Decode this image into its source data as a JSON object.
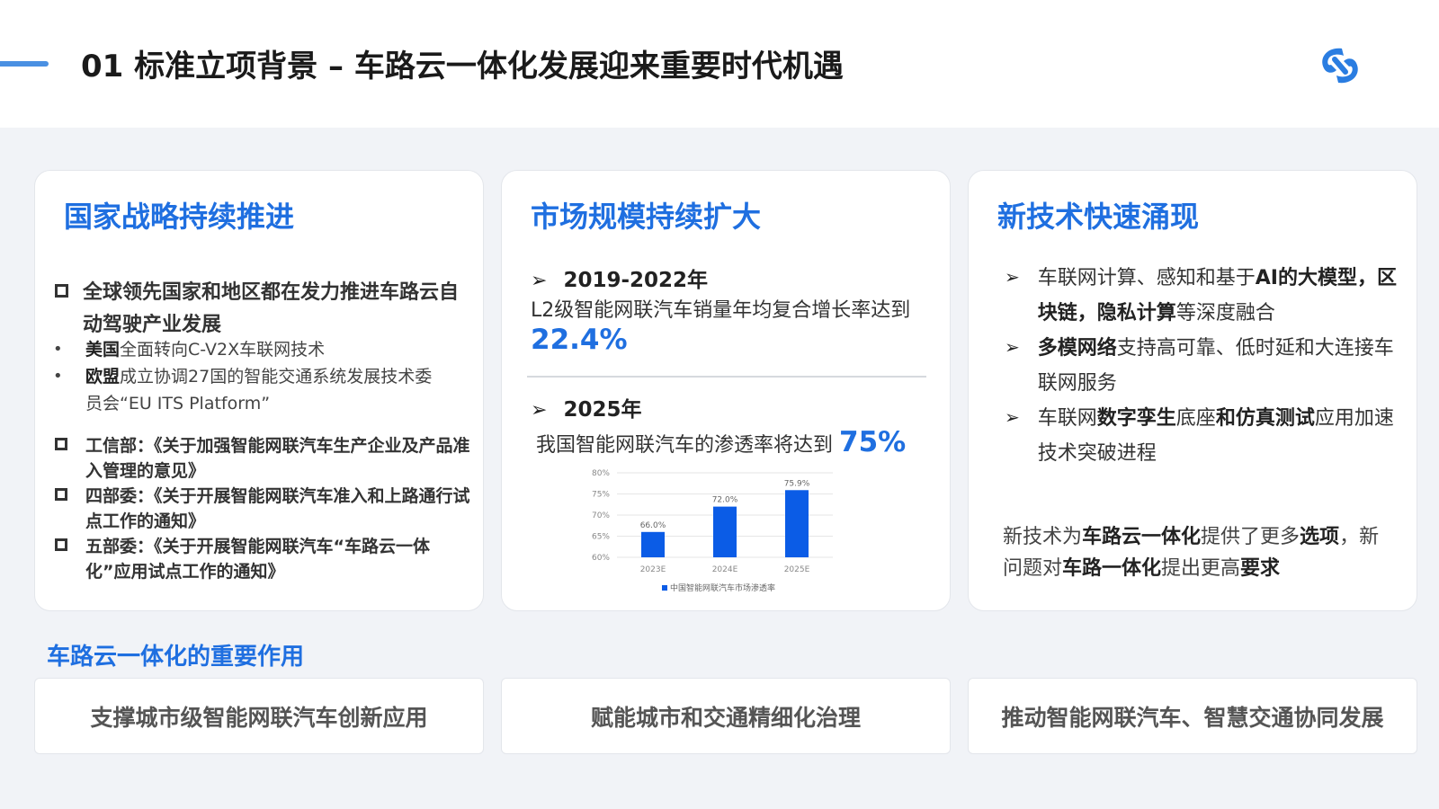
{
  "header": {
    "title": "01 标准立项背景 – 车路云一体化发展迎来重要时代机遇"
  },
  "card1": {
    "title": "国家战略持续推进",
    "main_point": "全球领先国家和地区都在发力推进车路云自动驾驶产业发展",
    "bullets": [
      {
        "bold": "美国",
        "text": "全面转向C-V2X车联网技术"
      },
      {
        "bold": "欧盟",
        "text": "成立协调27国的智能交通系统发展技术委员会“EU ITS Platform”"
      }
    ],
    "policies": [
      "工信部：《关于加强智能网联汽车生产企业及产品准入管理的意见》",
      "四部委：《关于开展智能网联汽车准入和上路通行试点工作的通知》",
      "五部委：《关于开展智能网联汽车“车路云一体化”应用试点工作的通知》"
    ]
  },
  "card2": {
    "title": "市场规模持续扩大",
    "arrow": "➢",
    "item1": {
      "heading": "2019-2022年",
      "text": "L2级智能网联汽车销量年均复合增长率达到",
      "value": "22.4%"
    },
    "item2": {
      "heading": "2025年",
      "text": "我国智能网联汽车的渗透率将达到",
      "value": "75%"
    }
  },
  "chart_data": {
    "type": "bar",
    "categories": [
      "2023E",
      "2024E",
      "2025E"
    ],
    "values": [
      66.0,
      72.0,
      75.9
    ],
    "value_labels": [
      "66.0%",
      "72.0%",
      "75.9%"
    ],
    "y_ticks": [
      "80%",
      "75%",
      "70%",
      "65%",
      "60%"
    ],
    "ylim": [
      60,
      80
    ],
    "legend": "中国智能网联汽车市场渗透率",
    "color": "#0b5ce6"
  },
  "card3": {
    "title": "新技术快速涌现",
    "items": [
      {
        "p1": "车联网计算、感知和基于",
        "b1": "AI的大模型",
        "p2": "，",
        "b2": "区块链",
        "p3": "，",
        "b3": "隐私计算",
        "p4": "等深度融合"
      },
      {
        "p1": "",
        "b1": "多模网络",
        "p2": "支持高可靠、低时延和大连接车联网服务",
        "b2": "",
        "p3": "",
        "b3": "",
        "p4": ""
      },
      {
        "p1": "车联网",
        "b1": "数字孪生",
        "p2": "底座",
        "b2": "和仿真测试",
        "p3": "应用加速技术突破进程",
        "b3": "",
        "p4": ""
      }
    ],
    "footer": {
      "p1": "新技术为",
      "b1": "车路云一体化",
      "p2": "提供了更多",
      "b2": "选项",
      "p3": "，新问题对",
      "b3": "车路一体化",
      "p4": "提出更高",
      "b4": "要求"
    }
  },
  "section": {
    "title": "车路云一体化的重要作用"
  },
  "roles": [
    "支撑城市级智能网联汽车创新应用",
    "赋能城市和交通精细化治理",
    "推动智能网联汽车、智慧交通协同发展"
  ],
  "colors": {
    "accent": "#1f6fe0",
    "bar": "#0b5ce6",
    "logo": "#2a7de1"
  }
}
